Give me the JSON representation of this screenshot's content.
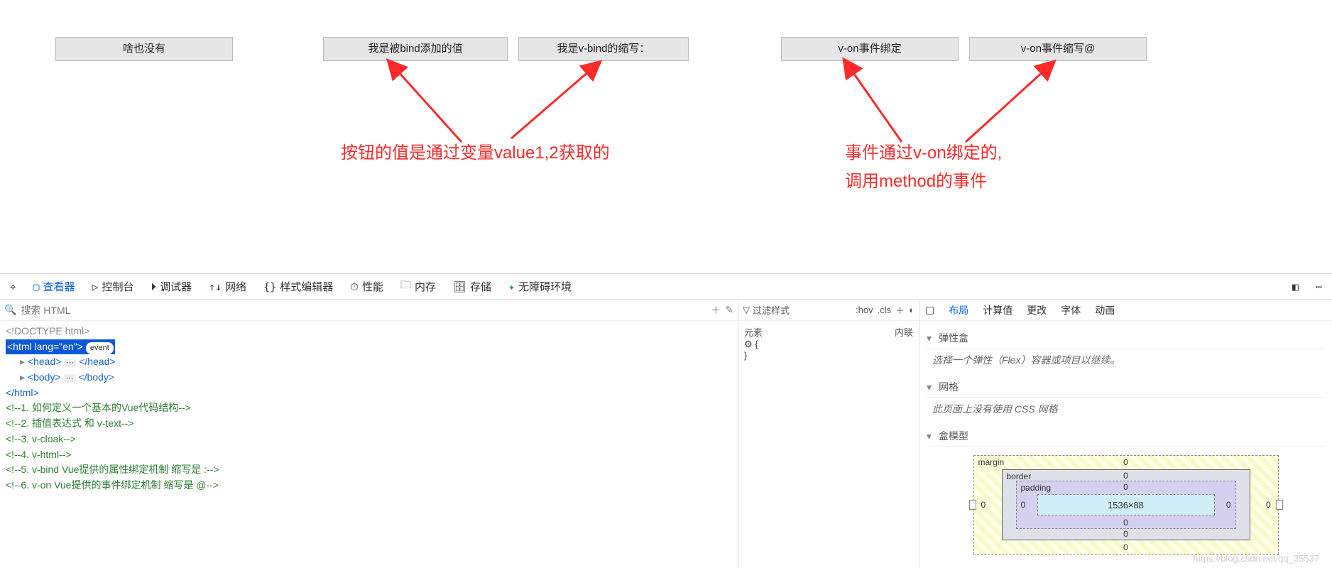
{
  "buttons": {
    "b1": "啥也没有",
    "b2": "我是被bind添加的值",
    "b3": "我是v-bind的缩写：",
    "b4": "v-on事件绑定",
    "b5": "v-on事件缩写@"
  },
  "annotations": {
    "left": "按钮的值是通过变量value1,2获取的",
    "rightA": "事件通过v-on绑定的,",
    "rightB": "调用method的事件"
  },
  "devtools": {
    "tabs": {
      "picker": "⎄",
      "inspector": "查看器",
      "console": "控制台",
      "debugger": "调试器",
      "network": "网络",
      "styleed": "样式编辑器",
      "perf": "性能",
      "memory": "内存",
      "storage": "存储",
      "a11y": "无障碍环境"
    },
    "search_placeholder": "搜索 HTML",
    "tree": {
      "doctype": "<!DOCTYPE html>",
      "html_open": "<html lang=\"en\">",
      "badge": "event",
      "head": "<head>",
      "head_close": "</head>",
      "body": "<body>",
      "body_close": "</body>",
      "html_close": "</html>",
      "c1": "<!--1. 如何定义一个基本的Vue代码结构-->",
      "c2": "<!--2. 插值表达式 和 v-text-->",
      "c3": "<!--3. v-cloak-->",
      "c4": "<!--4. v-html-->",
      "c5": "<!--5. v-bind Vue提供的属性绑定机制 缩写是 :-->",
      "c6": "<!--6. v-on Vue提供的事件绑定机制 缩写是 @-->"
    },
    "styles": {
      "filter": "过滤样式",
      "hov": ":hov",
      "cls": ".cls",
      "element_label": "元素",
      "inline_label": "内联",
      "selector": "⚙ {",
      "close": "}"
    },
    "layout": {
      "tabs": {
        "layout": "布局",
        "computed": "计算值",
        "changes": "更改",
        "fonts": "字体",
        "anim": "动画"
      },
      "flex_h": "弹性盒",
      "flex_msg": "选择一个弹性（Flex）容器或项目以继续。",
      "grid_h": "网格",
      "grid_msg": "此页面上没有使用 CSS 网格",
      "box_h": "盒模型",
      "box": {
        "margin": "margin",
        "border": "border",
        "padding": "padding",
        "content": "1536×88",
        "m": "0",
        "b": "0",
        "p": "0"
      }
    }
  },
  "watermark": "https://blog.csdn.net/qq_35537"
}
